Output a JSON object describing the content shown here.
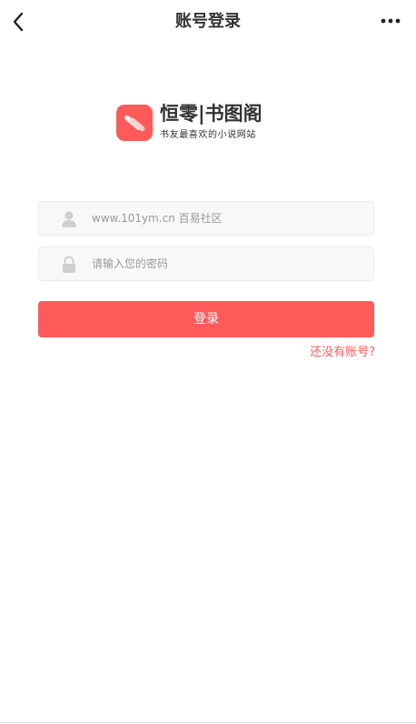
{
  "header": {
    "title": "账号登录",
    "back_icon": "chevron-left-icon",
    "more_icon": "more-dots-icon"
  },
  "brand": {
    "name": "恒零|书图阁",
    "slogan": "书友最喜欢的小说网站",
    "logo_color": "#ff5a5a"
  },
  "form": {
    "username_placeholder": "www.101ym.cn 百易社区",
    "username_value": "",
    "username_icon": "user-icon",
    "password_placeholder": "请输入您的密码",
    "password_value": "",
    "password_icon": "lock-icon",
    "login_label": "登录",
    "register_link": "还没有账号?"
  },
  "colors": {
    "accent": "#ff5a5a",
    "input_bg": "#f8f8f8"
  }
}
